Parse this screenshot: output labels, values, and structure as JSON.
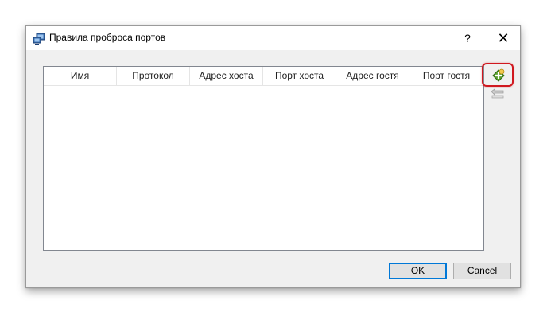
{
  "window": {
    "title": "Правила проброса портов",
    "help_label": "?",
    "close_label": "✕"
  },
  "table": {
    "columns": [
      "Имя",
      "Протокол",
      "Адрес хоста",
      "Порт хоста",
      "Адрес гостя",
      "Порт гостя"
    ],
    "rows": []
  },
  "side_buttons": {
    "add_icon": "add-rule-icon",
    "remove_icon": "remove-rule-icon"
  },
  "footer": {
    "ok_label": "OK",
    "cancel_label": "Cancel"
  },
  "colors": {
    "highlight": "#d0181f",
    "default_button_border": "#0078d7"
  }
}
